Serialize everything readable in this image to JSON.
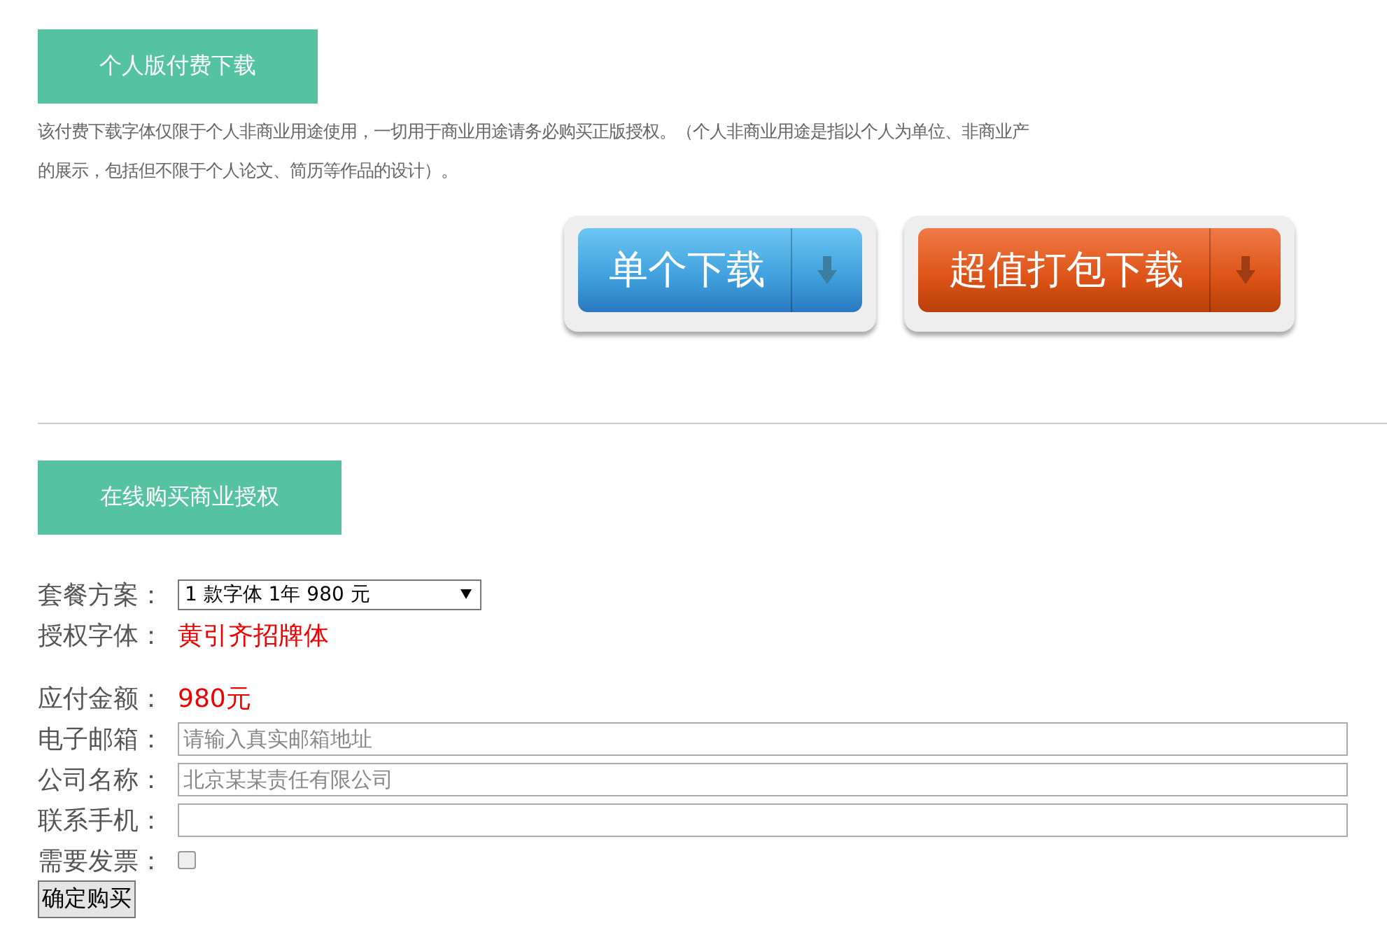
{
  "personal_section": {
    "heading_button": "个人版付费下载",
    "notice_lines": [
      "该付费下载字体仅限于个人非商业用途使用，一切用于商业用途请务必购买正版授权。（个人非商业用途是指以个人为单位、非商业产",
      "的展示，包括但不限于个人论文、简历等作品的设计）。"
    ],
    "download_buttons": [
      {
        "label": "单个下载",
        "kind": "blue"
      },
      {
        "label": "超值打包下载",
        "kind": "orange"
      }
    ]
  },
  "commercial_section": {
    "heading_button": "在线购买商业授权",
    "form": [
      {
        "kind": "select",
        "label": "套餐方案：",
        "value": "1 款字体 1年 980 元"
      },
      {
        "kind": "text",
        "label": "授权字体：",
        "value": "黄引齐招牌体"
      },
      {
        "kind": "spacer"
      },
      {
        "kind": "text",
        "label": "应付金额：",
        "value": "980元"
      },
      {
        "kind": "input",
        "label": "电子邮箱：",
        "placeholder": "请输入真实邮箱地址"
      },
      {
        "kind": "input",
        "label": "公司名称：",
        "placeholder": "北京某某责任有限公司"
      },
      {
        "kind": "input",
        "label": "联系手机："
      },
      {
        "kind": "checkbox",
        "label": "需要发票：",
        "checked": false
      }
    ],
    "submit_button": "确定购买"
  }
}
